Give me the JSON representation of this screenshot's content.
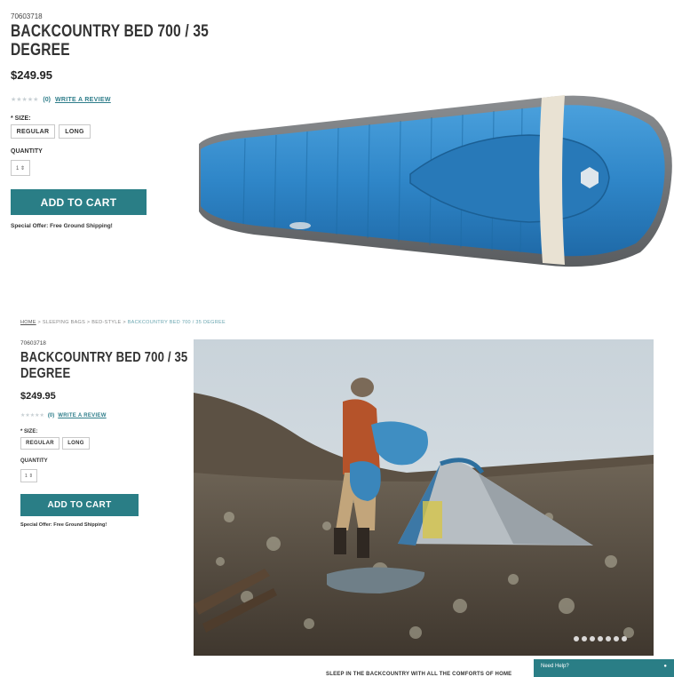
{
  "top": {
    "sku": "70603718",
    "title_line1": "BACKCOUNTRY BED 700 / 35",
    "title_line2": "DEGREE",
    "price": "$249.95",
    "rating_stars": "★★★★★",
    "rating_count": "(0)",
    "review_link": "WRITE A REVIEW",
    "size_label": "* SIZE:",
    "sizes": [
      "REGULAR",
      "LONG"
    ],
    "quantity_label": "QUANTITY",
    "quantity_value": "1 ⇕",
    "add_to_cart": "ADD TO CART",
    "special_offer": "Special Offer: Free Ground Shipping!"
  },
  "bottom": {
    "breadcrumb": {
      "home": "HOME",
      "sep1": " > SLEEPING BAGS > BED-STYLE > ",
      "current": "BACKCOUNTRY BED 700 / 35 DEGREE"
    },
    "sku": "70603718",
    "title_line1": "BACKCOUNTRY BED 700 / 35",
    "title_line2": "DEGREE",
    "price": "$249.95",
    "rating_stars": "★★★★★",
    "rating_count": "(0)",
    "review_link": "WRITE A REVIEW",
    "size_label": "* SIZE:",
    "sizes": [
      "REGULAR",
      "LONG"
    ],
    "quantity_label": "QUANTITY",
    "quantity_value": "1 ⇕",
    "add_to_cart": "ADD TO CART",
    "special_offer": "Special Offer: Free Ground Shipping!",
    "caption": "SLEEP IN THE BACKCOUNTRY WITH ALL THE COMFORTS OF HOME",
    "help": "Need Help?",
    "carousel_dot_count": 7
  },
  "colors": {
    "accent": "#2a7e86",
    "bag_blue": "#2f86c8",
    "bag_grey": "#6b6f72",
    "bag_band": "#e9e2d3"
  },
  "icons": {
    "help": "chat-icon",
    "quantity": "stepper-icon"
  }
}
